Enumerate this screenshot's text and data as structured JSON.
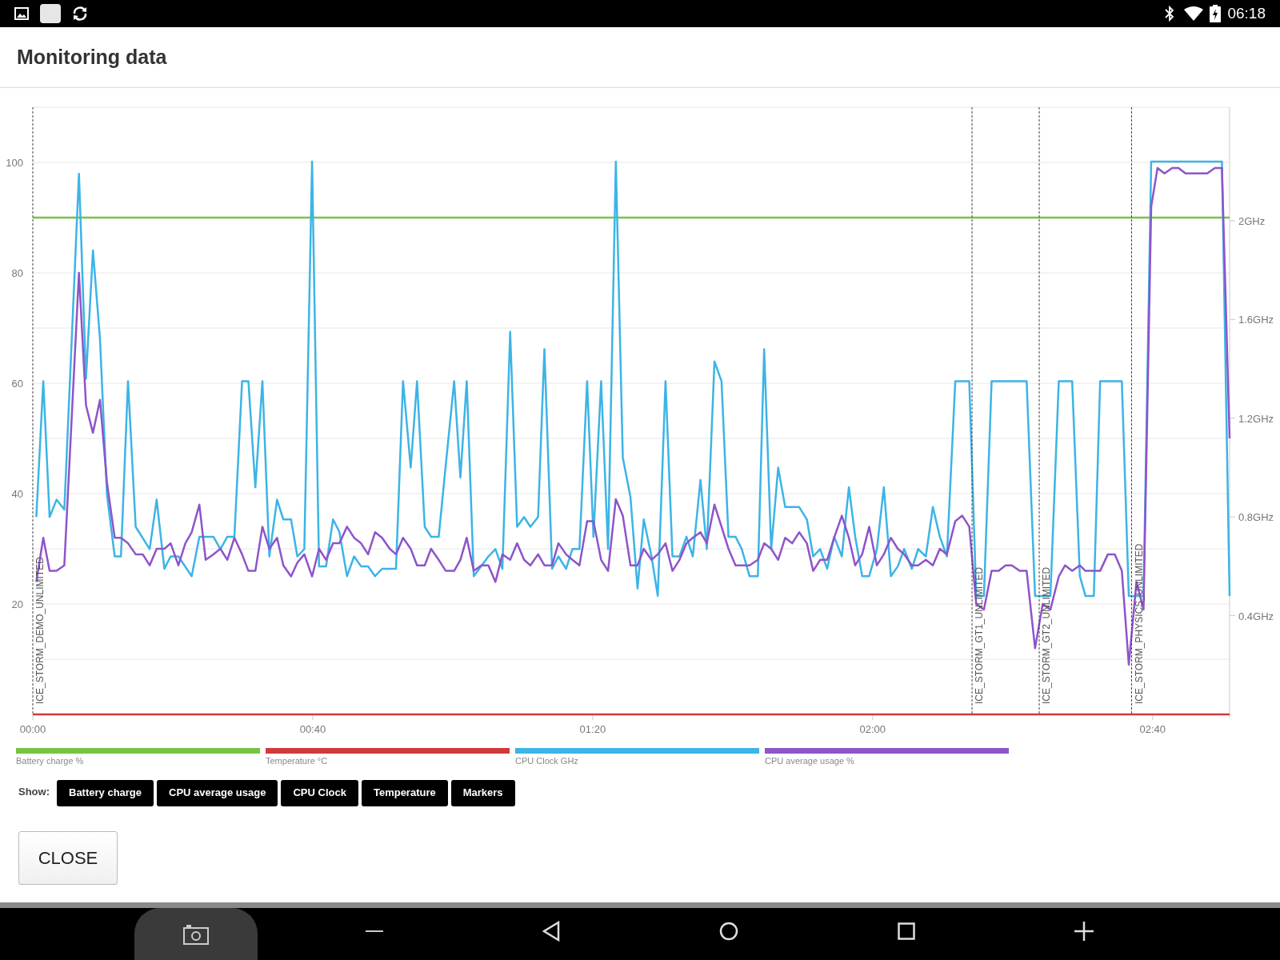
{
  "status_bar": {
    "time": "06:18"
  },
  "header": {
    "title": "Monitoring data"
  },
  "chart": {
    "chart_data": {
      "type": "line",
      "xlim": [
        0,
        171
      ],
      "ylim": [
        0,
        110
      ],
      "y2lim": [
        0,
        2.46
      ],
      "xticks": [
        {
          "value": 0,
          "label": "00:00"
        },
        {
          "value": 40,
          "label": "00:40"
        },
        {
          "value": 80,
          "label": "01:20"
        },
        {
          "value": 120,
          "label": "02:00"
        },
        {
          "value": 160,
          "label": "02:40"
        }
      ],
      "yticks": [
        20,
        40,
        60,
        80,
        100
      ],
      "y2ticks": [
        {
          "value": 0.4,
          "label": "0.4GHz"
        },
        {
          "value": 0.8,
          "label": "0.8GHz"
        },
        {
          "value": 1.2,
          "label": "1.2GHz"
        },
        {
          "value": 1.6,
          "label": "1.6GHz"
        },
        {
          "value": 2,
          "label": "2GHz"
        }
      ],
      "series": [
        {
          "name": "Battery charge %",
          "color": "#76c442",
          "x": [
            0,
            171
          ],
          "values": [
            90,
            90
          ]
        },
        {
          "name": "Temperature °C",
          "color": "#d13a3a",
          "x": [
            0,
            171
          ],
          "values": [
            0,
            0
          ]
        },
        {
          "name": "CPU Clock GHz",
          "color": "#3cb4e6",
          "axis": "y2",
          "x": [
            0.5,
            1.5,
            2.4,
            3.4,
            4.5,
            6.6,
            7.6,
            8.6,
            9.6,
            10.6,
            11.7,
            12.6,
            13.6,
            14.7,
            16.7,
            17.7,
            18.8,
            19.7,
            20.8,
            22.7,
            23.8,
            25.8,
            26.8,
            27.8,
            28.8,
            29.9,
            30.8,
            31.8,
            32.8,
            33.8,
            34.9,
            35.8,
            36.9,
            37.8,
            38.8,
            39.9,
            40.9,
            41.9,
            42.9,
            43.8,
            44.9,
            45.9,
            46.9,
            47.9,
            48.9,
            49.9,
            51.9,
            52.9,
            54.0,
            54.9,
            56.0,
            56.9,
            58.0,
            59.0,
            60.2,
            61.1,
            62.0,
            63.0,
            65.1,
            66.1,
            67.1,
            68.2,
            69.2,
            70.2,
            71.1,
            72.2,
            73.1,
            74.2,
            75.1,
            76.2,
            77.1,
            78.1,
            79.2,
            80.1,
            81.2,
            82.2,
            83.3,
            84.3,
            85.4,
            86.4,
            87.3,
            88.4,
            89.3,
            90.4,
            91.4,
            92.4,
            93.4,
            94.3,
            95.4,
            96.3,
            97.4,
            98.4,
            99.4,
            100.4,
            101.3,
            102.4,
            103.6,
            104.5,
            105.5,
            106.5,
            107.5,
            109.5,
            110.6,
            111.5,
            112.5,
            113.5,
            114.5,
            115.6,
            116.6,
            117.5,
            118.5,
            119.5,
            120.6,
            121.6,
            122.6,
            123.6,
            124.5,
            125.6,
            126.5,
            127.6,
            128.6,
            129.6,
            130.6,
            131.8,
            133.8,
            134.8,
            135.9,
            137.0,
            142.0,
            143.2,
            145.4,
            146.6,
            148.5,
            149.6,
            150.4,
            151.6,
            152.5,
            155.6,
            156.6,
            158.7,
            159.8,
            169.9,
            171.0
          ],
          "values": [
            0.8,
            1.35,
            0.8,
            0.87,
            0.83,
            2.19,
            1.36,
            1.88,
            1.52,
            0.89,
            0.64,
            0.64,
            1.35,
            0.76,
            0.67,
            0.87,
            0.59,
            0.64,
            0.64,
            0.56,
            0.72,
            0.72,
            0.67,
            0.72,
            0.72,
            1.35,
            1.35,
            0.92,
            1.35,
            0.64,
            0.87,
            0.79,
            0.79,
            0.64,
            0.67,
            2.24,
            0.6,
            0.6,
            0.79,
            0.74,
            0.56,
            0.64,
            0.6,
            0.6,
            0.56,
            0.59,
            0.59,
            1.35,
            1.0,
            1.35,
            0.76,
            0.72,
            0.72,
            1.01,
            1.35,
            0.96,
            1.35,
            0.56,
            0.64,
            0.67,
            0.59,
            1.55,
            0.76,
            0.8,
            0.76,
            0.8,
            1.48,
            0.59,
            0.64,
            0.59,
            0.67,
            0.67,
            1.35,
            0.72,
            1.35,
            0.67,
            2.24,
            1.04,
            0.88,
            0.51,
            0.79,
            0.64,
            0.48,
            1.35,
            0.64,
            0.64,
            0.72,
            0.64,
            0.95,
            0.67,
            1.43,
            1.35,
            0.72,
            0.72,
            0.67,
            0.56,
            0.56,
            1.48,
            0.67,
            1.0,
            0.84,
            0.84,
            0.79,
            0.64,
            0.67,
            0.59,
            0.72,
            0.64,
            0.92,
            0.72,
            0.56,
            0.56,
            0.67,
            0.92,
            0.56,
            0.6,
            0.67,
            0.59,
            0.67,
            0.64,
            0.84,
            0.72,
            0.64,
            1.35,
            1.35,
            0.48,
            0.48,
            1.35,
            1.35,
            0.48,
            0.48,
            1.35,
            1.35,
            0.56,
            0.48,
            0.48,
            1.35,
            1.35,
            0.48,
            0.48,
            2.24,
            2.24,
            0.48
          ]
        },
        {
          "name": "CPU average usage %",
          "color": "#8e54c9",
          "x": [
            0.5,
            1.5,
            2.4,
            3.4,
            4.5,
            6.6,
            7.6,
            8.6,
            9.6,
            10.6,
            11.7,
            12.6,
            13.6,
            14.7,
            15.7,
            16.7,
            17.7,
            18.8,
            19.7,
            20.8,
            21.8,
            22.7,
            23.8,
            24.7,
            25.8,
            26.8,
            27.8,
            28.8,
            29.9,
            30.8,
            31.8,
            32.8,
            33.8,
            34.9,
            35.8,
            36.9,
            37.8,
            38.8,
            39.9,
            40.9,
            41.9,
            42.9,
            43.8,
            44.9,
            45.9,
            46.9,
            47.9,
            48.9,
            49.9,
            51.0,
            51.9,
            52.9,
            54.0,
            54.9,
            56.0,
            56.9,
            58.0,
            59.0,
            60.2,
            61.1,
            62.0,
            63.0,
            64.1,
            65.1,
            66.1,
            67.1,
            68.2,
            69.2,
            70.2,
            71.1,
            72.2,
            73.1,
            74.2,
            75.1,
            76.2,
            77.1,
            78.1,
            79.2,
            80.1,
            81.2,
            82.2,
            83.3,
            84.3,
            85.4,
            86.4,
            87.3,
            88.4,
            89.3,
            90.4,
            91.4,
            92.4,
            93.4,
            94.3,
            95.4,
            96.3,
            97.4,
            98.4,
            99.4,
            100.4,
            101.3,
            102.4,
            103.6,
            104.5,
            105.5,
            106.5,
            107.5,
            108.5,
            109.5,
            110.6,
            111.5,
            112.5,
            113.5,
            114.5,
            115.6,
            116.6,
            117.5,
            118.5,
            119.5,
            120.6,
            121.6,
            122.6,
            123.6,
            124.5,
            125.6,
            126.5,
            127.6,
            128.6,
            129.6,
            130.6,
            131.8,
            132.8,
            133.8,
            134.8,
            135.9,
            137.0,
            138.0,
            139.0,
            139.9,
            141.0,
            142.0,
            143.2,
            144.3,
            145.4,
            146.6,
            147.5,
            148.5,
            149.6,
            150.4,
            151.6,
            152.5,
            153.6,
            154.6,
            155.6,
            156.6,
            157.7,
            158.7,
            159.8,
            160.7,
            161.7,
            162.8,
            163.7,
            164.7,
            167.8,
            168.9,
            169.9,
            171.0
          ],
          "values": [
            24,
            32,
            26,
            26,
            27,
            80,
            56,
            51,
            57,
            42,
            32,
            32,
            31,
            29,
            29,
            27,
            30,
            30,
            31,
            27,
            31,
            33,
            38,
            28,
            29,
            30,
            28,
            32,
            29,
            26,
            26,
            34,
            30,
            32,
            27,
            25,
            27.5,
            29,
            25,
            30,
            28,
            31,
            31,
            34,
            32,
            31,
            29,
            33,
            32,
            30,
            29,
            32,
            30,
            27,
            27,
            30,
            28,
            26,
            26,
            28,
            32,
            26,
            27,
            27,
            24,
            29,
            28,
            31,
            28,
            27,
            29,
            27,
            27,
            31,
            29,
            28,
            27,
            35,
            35,
            28,
            26,
            39,
            36,
            27,
            27,
            30,
            28,
            29,
            31,
            26,
            28,
            31,
            32,
            33,
            31,
            38,
            34,
            30,
            27,
            27,
            27,
            28,
            31,
            30,
            28,
            32,
            31,
            33,
            31,
            26,
            28,
            28,
            32,
            36,
            32,
            27,
            29,
            34,
            27,
            29,
            32,
            30,
            29,
            27,
            27,
            28,
            27,
            30,
            29,
            35,
            36,
            34,
            20,
            19,
            26,
            26,
            27,
            27,
            26,
            26,
            12,
            20,
            19,
            25,
            27,
            26,
            27,
            26,
            26,
            26,
            29,
            29,
            26,
            9,
            24,
            19,
            92,
            99,
            98,
            99,
            99,
            98,
            98,
            99,
            99,
            50
          ]
        }
      ],
      "grid": true,
      "ref_lines": [
        {
          "axis": "x",
          "value": 0,
          "label": "ICE_STORM_DEMO_UNLIMITED"
        },
        {
          "axis": "x",
          "value": 134.2,
          "label": "ICE_STORM_GT1_UNLIMITED"
        },
        {
          "axis": "x",
          "value": 143.8,
          "label": "ICE_STORM_GT2_UNLIMITED"
        },
        {
          "axis": "x",
          "value": 157.0,
          "label": "ICE_STORM_PHYSICS_UNLIMITED"
        }
      ]
    }
  },
  "show": {
    "label": "Show:",
    "buttons": [
      "Battery charge",
      "CPU average usage",
      "CPU Clock",
      "Temperature",
      "Markers"
    ]
  },
  "close_button": {
    "label": "CLOSE"
  }
}
